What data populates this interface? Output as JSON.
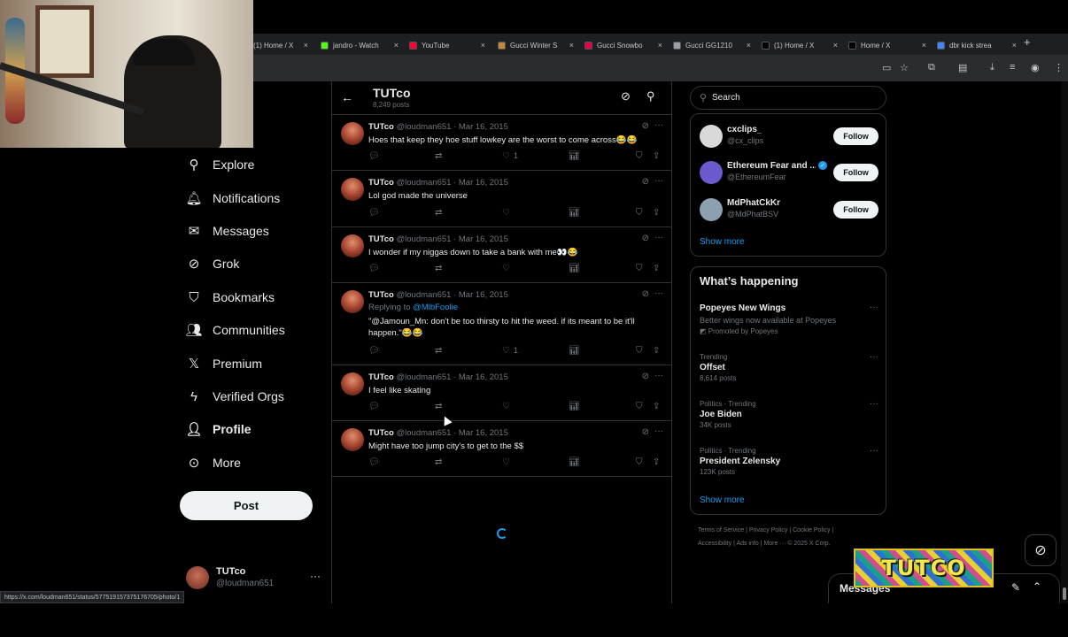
{
  "browser": {
    "tabs": [
      {
        "label": "(1) Home / X",
        "color": "#000000"
      },
      {
        "label": "jandro - Watch",
        "color": "#53fc18"
      },
      {
        "label": "YouTube",
        "color": "#ff0033"
      },
      {
        "label": "Gucci Winter S",
        "color": "#c08a3a"
      },
      {
        "label": "Gucci Snowbo",
        "color": "#e6004c"
      },
      {
        "label": "Gucci GG1210",
        "color": "#9aa0a6"
      },
      {
        "label": "(1) Home / X",
        "color": "#000000"
      },
      {
        "label": "Home / X",
        "color": "#000000"
      },
      {
        "label": "dbr kick strea",
        "color": "#4285f4"
      }
    ],
    "close_glyph": "×",
    "new_tab_glyph": "+",
    "status_url": "https://x.com/loudman651/status/577519157375176705/photo/1"
  },
  "nav": {
    "items": [
      {
        "label": "Explore",
        "icon": "search-icon",
        "glyph": "⚲"
      },
      {
        "label": "Notifications",
        "icon": "bell-icon",
        "glyph": "🔔︎"
      },
      {
        "label": "Messages",
        "icon": "envelope-icon",
        "glyph": "✉"
      },
      {
        "label": "Grok",
        "icon": "grok-icon",
        "glyph": "⊘"
      },
      {
        "label": "Bookmarks",
        "icon": "bookmark-icon",
        "glyph": "⛉"
      },
      {
        "label": "Communities",
        "icon": "communities-icon",
        "glyph": "👥︎"
      },
      {
        "label": "Premium",
        "icon": "x-logo-icon",
        "glyph": "𝕏"
      },
      {
        "label": "Verified Orgs",
        "icon": "lightning-icon",
        "glyph": "ϟ"
      },
      {
        "label": "Profile",
        "icon": "person-icon",
        "glyph": "👤︎"
      },
      {
        "label": "More",
        "icon": "more-circle-icon",
        "glyph": "⊙"
      }
    ],
    "post_label": "Post",
    "account": {
      "name": "TUTco",
      "handle": "@loudman651",
      "menu_glyph": "···"
    }
  },
  "profile_header": {
    "back_glyph": "←",
    "title": "TUTco",
    "subtitle": "8,249 posts",
    "grok_glyph": "⊘",
    "search_glyph": "⚲"
  },
  "tweets": [
    {
      "name": "TUTco",
      "handle_date": "@loudman651 · Mar 16, 2015",
      "text": "Hoes that keep they hoe stuff lowkey are the worst to come across😂😂",
      "likes": "1"
    },
    {
      "name": "TUTco",
      "handle_date": "@loudman651 · Mar 16, 2015",
      "text": "Lol god made the universe",
      "likes": ""
    },
    {
      "name": "TUTco",
      "handle_date": "@loudman651 · Mar 16, 2015",
      "text": "I wonder if my niggas down to take a bank with me👀😂",
      "likes": ""
    },
    {
      "name": "TUTco",
      "handle_date": "@loudman651 · Mar 16, 2015",
      "reply_prefix": "Replying to ",
      "reply_user": "@MlbFoolie",
      "text": "\"@Jamoun_Mn: don't be too thirsty to hit the weed. if its meant to be it'll happen.\"😂😂",
      "likes": "1"
    },
    {
      "name": "TUTco",
      "handle_date": "@loudman651 · Mar 16, 2015",
      "text": "I feel like skating",
      "likes": ""
    },
    {
      "name": "TUTco",
      "handle_date": "@loudman651 · Mar 16, 2015",
      "text": "Might have too jump city's to get to the $$",
      "likes": ""
    }
  ],
  "tweet_actions": {
    "reply": "💬︎",
    "retweet": "⇄",
    "like": "♡",
    "views": "📊︎",
    "bookmark": "⛉",
    "share": "⇪",
    "grok": "⊘",
    "more": "···"
  },
  "search": {
    "placeholder": "Search",
    "glyph": "⚲"
  },
  "who_to_follow": {
    "accounts": [
      {
        "name": "cxclips_",
        "handle": "@cx_clips",
        "color": "#d9d9d9",
        "verified": false
      },
      {
        "name": "Ethereum Fear and ...",
        "handle": "@EthereumFear",
        "color": "#6a5acd",
        "verified": true
      },
      {
        "name": "MdPhatCkKr",
        "handle": "@MdPhatBSV",
        "color": "#8ca0b0",
        "verified": false
      }
    ],
    "follow_label": "Follow",
    "show_more": "Show more",
    "verified_glyph": "✓"
  },
  "whats_happening": {
    "title": "What’s happening",
    "promo": {
      "title": "Popeyes New Wings",
      "desc": "Better wings now available at Popeyes",
      "promoted": "Promoted by Popeyes"
    },
    "trends": [
      {
        "context": "Trending",
        "title": "Offset",
        "count": "8,614 posts"
      },
      {
        "context": "Politics · Trending",
        "title": "Joe Biden",
        "count": "34K posts"
      },
      {
        "context": "Politics · Trending",
        "title": "President Zelensky",
        "count": "123K posts"
      }
    ],
    "show_more": "Show more",
    "menu_glyph": "···"
  },
  "footer": {
    "line1": "Terms of Service  |  Privacy Policy  |  Cookie Policy  |",
    "line2": "Accessibility  |  Ads info  |  More ···  © 2025 X Corp."
  },
  "messages_drawer": {
    "title": "Messages",
    "compose_glyph": "✎",
    "expand_glyph": "⌃"
  },
  "overlay_logo": {
    "text": "TUTCO"
  },
  "colors": {
    "accent": "#1d9bf0",
    "background": "#000000",
    "border": "#2f3336",
    "muted": "#71767b"
  }
}
